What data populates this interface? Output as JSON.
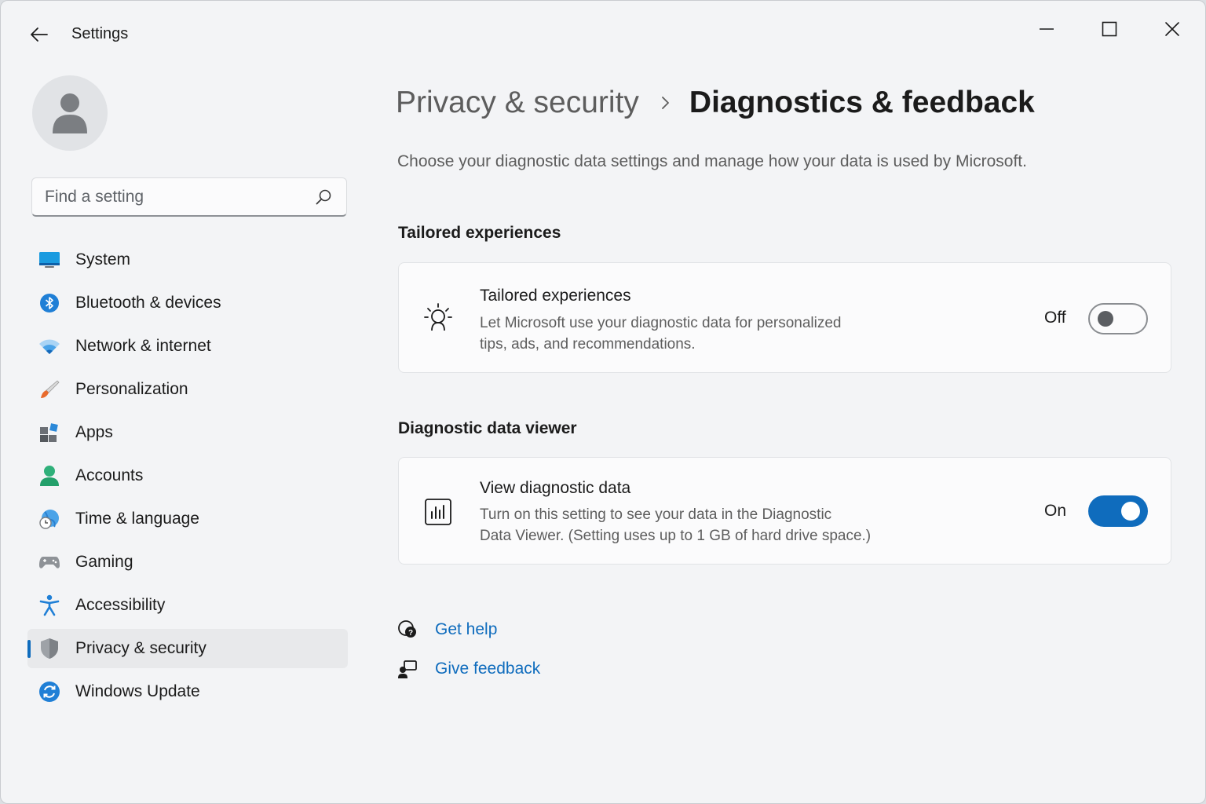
{
  "window": {
    "title": "Settings"
  },
  "search": {
    "placeholder": "Find a setting"
  },
  "sidebar": {
    "items": [
      {
        "label": "System",
        "icon": "system-icon"
      },
      {
        "label": "Bluetooth & devices",
        "icon": "bluetooth-icon"
      },
      {
        "label": "Network & internet",
        "icon": "wifi-icon"
      },
      {
        "label": "Personalization",
        "icon": "brush-icon"
      },
      {
        "label": "Apps",
        "icon": "apps-icon"
      },
      {
        "label": "Accounts",
        "icon": "person-icon"
      },
      {
        "label": "Time & language",
        "icon": "globe-clock-icon"
      },
      {
        "label": "Gaming",
        "icon": "gamepad-icon"
      },
      {
        "label": "Accessibility",
        "icon": "accessibility-icon"
      },
      {
        "label": "Privacy & security",
        "icon": "shield-icon",
        "active": true
      },
      {
        "label": "Windows Update",
        "icon": "update-icon"
      }
    ]
  },
  "breadcrumb": {
    "parent": "Privacy & security",
    "current": "Diagnostics & feedback"
  },
  "page": {
    "subtitle": "Choose your diagnostic data settings and manage how your data is used by Microsoft."
  },
  "sections": {
    "tailored": {
      "heading": "Tailored experiences",
      "title": "Tailored experiences",
      "desc_line1": "Let Microsoft use your diagnostic data for personalized",
      "desc_line2": "tips, ads, and recommendations.",
      "state": "Off",
      "enabled": false,
      "icon": "lightbulb-person-icon"
    },
    "viewer": {
      "heading": "Diagnostic data viewer",
      "title": "View diagnostic data",
      "desc_line1": "Turn on this setting to see your data in the Diagnostic",
      "desc_line2": "Data Viewer. (Setting uses up to 1 GB of hard drive space.)",
      "state": "On",
      "enabled": true,
      "icon": "chart-icon"
    }
  },
  "help": {
    "get_help": "Get help",
    "give_feedback": "Give feedback"
  },
  "colors": {
    "accent": "#0f6cbd",
    "window_bg": "#f3f4f6",
    "card_bg": "#fbfbfc"
  }
}
